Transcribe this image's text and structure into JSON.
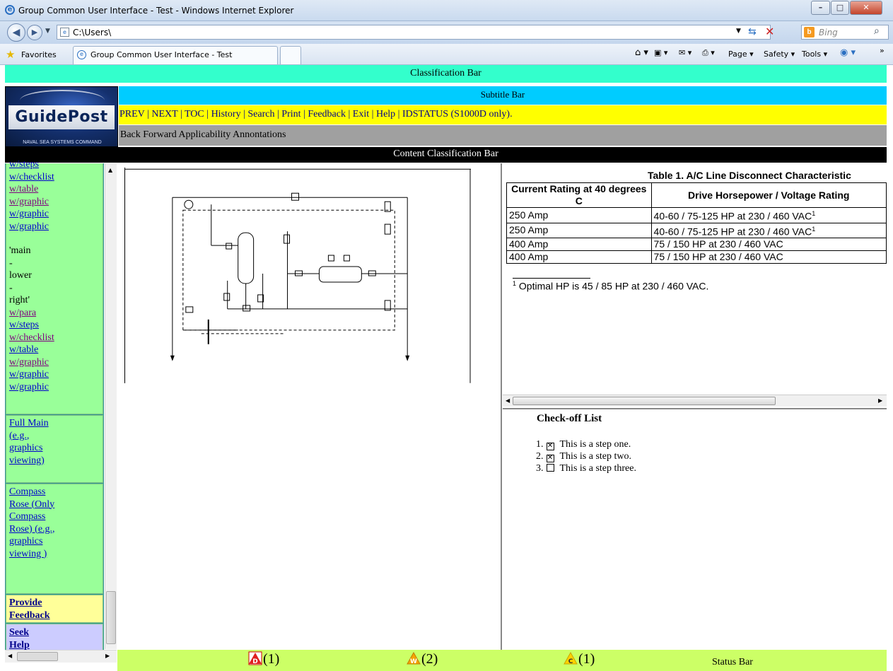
{
  "browser": {
    "window_title": "Group Common User Interface - Test - Windows Internet Explorer",
    "address": "C:\\Users\\",
    "search_placeholder": "Bing",
    "favorites_label": "Favorites",
    "tab_label": "Group Common User Interface - Test",
    "commands": [
      "Page ▾",
      "Safety ▾",
      "Tools ▾"
    ]
  },
  "app": {
    "classification_bar": "Classification Bar",
    "subtitle_bar": "Subtitle Bar",
    "logo_text": "GuidePost",
    "logo_subtext": "NAVAL SEA SYSTEMS COMMAND",
    "nav_links": [
      "PREV",
      "NEXT",
      "TOC",
      "History",
      "Search",
      "Print",
      "Feedback",
      "Exit",
      "Help",
      "IDSTATUS (S1000D only)."
    ],
    "annotation_bar": "Back Forward Applicability Annontations",
    "content_classification_bar": "Content Classification Bar"
  },
  "toc": {
    "group1": [
      "w/steps",
      "w/checklist",
      "w/table",
      "w/graphic",
      "w/graphic",
      "w/graphic"
    ],
    "plain": [
      "'main",
      "-",
      "lower",
      "-",
      "right'"
    ],
    "group1b": [
      "w/para",
      "w/steps",
      "w/checklist",
      "w/table",
      "w/graphic",
      "w/graphic",
      "w/graphic"
    ],
    "group2": "Full Main (e.g., graphics viewing)",
    "group3": "Compass Rose (Only Compass Rose) (e.g., graphics viewing )",
    "feedback": "Provide Feedback",
    "help": "Seek Help"
  },
  "table": {
    "title": "Table 1.  A/C Line Disconnect Characteristic",
    "headers": [
      "Current Rating at 40 degrees C",
      "Drive Horsepower / Voltage Rating"
    ],
    "rows": [
      [
        "250 Amp",
        "40-60 / 75-125 HP at 230 / 460 VAC",
        "1"
      ],
      [
        "250 Amp",
        "40-60 / 75-125 HP at 230 / 460 VAC",
        "1"
      ],
      [
        "400 Amp",
        "75 / 150 HP at 230 / 460 VAC",
        ""
      ],
      [
        "400 Amp",
        "75 / 150 HP at 230 / 460 VAC",
        ""
      ]
    ],
    "footnote_mark": "1",
    "footnote": "Optimal HP is 45 / 85 HP at 230 / 460 VAC."
  },
  "checklist": {
    "title": "Check-off List",
    "items": [
      {
        "num": "1.",
        "text": "This is a step one.",
        "checked": true
      },
      {
        "num": "2.",
        "text": "This is a step two.",
        "checked": true
      },
      {
        "num": "3.",
        "text": "This is a step three.",
        "checked": false
      }
    ]
  },
  "status": {
    "danger_letter": "D",
    "danger_count": "(1)",
    "warning_letter": "W",
    "warning_count": "(2)",
    "caution_letter": "C",
    "caution_count": "(1)",
    "label": "Status Bar"
  },
  "colors": {
    "classification": "#33ffcc",
    "subtitle": "#00ccff",
    "nav": "#ffff00",
    "annotation": "#a0a0a0",
    "toc_bg": "#339999",
    "toc_group": "#99ff99",
    "status": "#ccff66",
    "feedback": "#ffff99",
    "help": "#ccccff"
  }
}
